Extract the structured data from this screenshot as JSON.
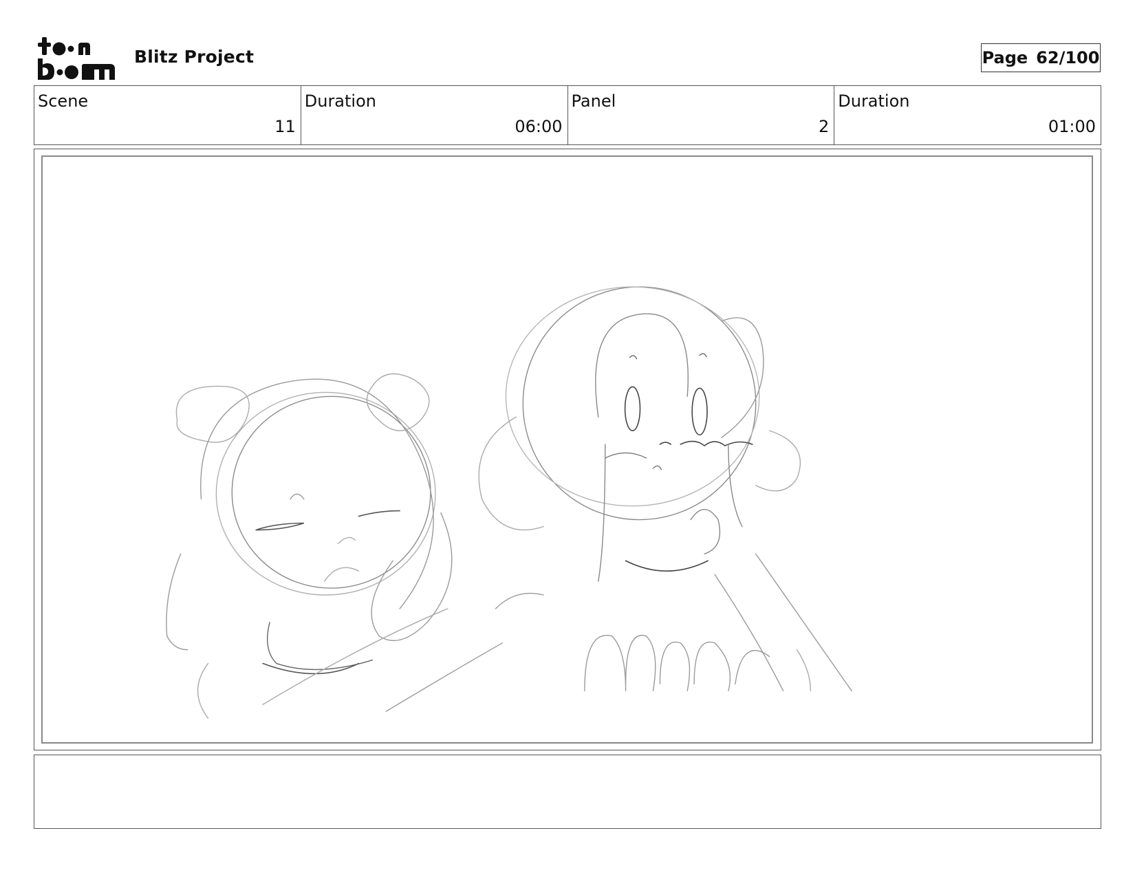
{
  "header": {
    "logo_text": "toon boom",
    "project_title": "Blitz Project",
    "page_label": "Page",
    "page_number": "62/100"
  },
  "info": {
    "scene_label": "Scene",
    "scene_value": "11",
    "scene_duration_label": "Duration",
    "scene_duration_value": "06:00",
    "panel_label": "Panel",
    "panel_value": "2",
    "panel_duration_label": "Duration",
    "panel_duration_value": "01:00"
  },
  "panel": {
    "sketch_content": "rough pencil sketch of two characters"
  },
  "caption": {
    "text": ""
  }
}
